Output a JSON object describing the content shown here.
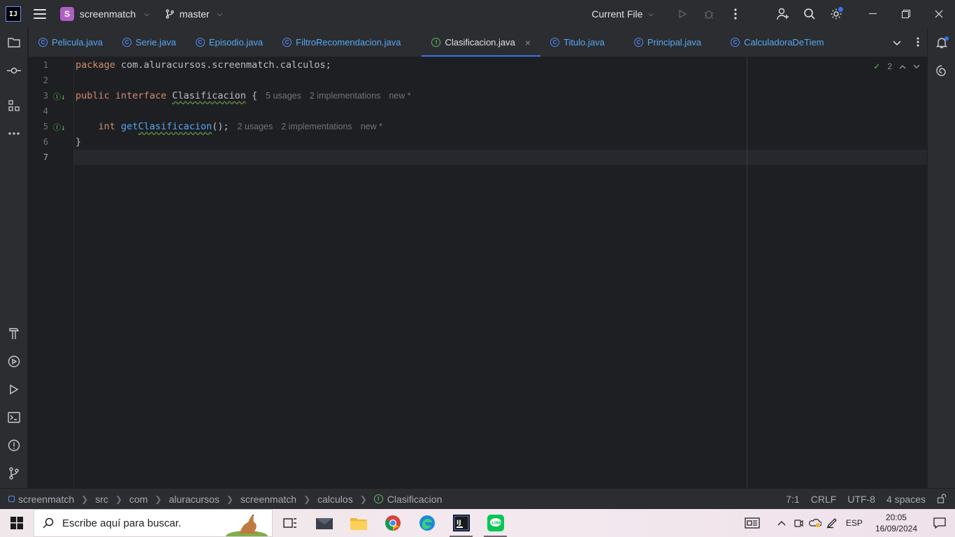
{
  "titlebar": {
    "logo_text": "IJ",
    "project_initial": "S",
    "project_name": "screenmatch",
    "branch": "master",
    "run_config": "Current File"
  },
  "tabs": [
    {
      "label": "Pelicula.java",
      "active": false
    },
    {
      "label": "Serie.java",
      "active": false
    },
    {
      "label": "Episodio.java",
      "active": false
    },
    {
      "label": "FiltroRecomendacion.java",
      "active": false
    },
    {
      "label": "Clasificacion.java",
      "active": true
    },
    {
      "label": "Titulo.java",
      "active": false
    },
    {
      "label": "Principal.java",
      "active": false
    },
    {
      "label": "CalculadoraDeTiem",
      "active": false
    }
  ],
  "editor": {
    "line_numbers": [
      "1",
      "2",
      "3",
      "4",
      "5",
      "6",
      "7"
    ],
    "inspection_count": "2",
    "line1": {
      "kw": "package",
      "rest": " com.aluracursos.screenmatch.calculos;"
    },
    "line3": {
      "kw1": "public",
      "kw2": "interface",
      "type": "Clasificacion",
      "rest": " {",
      "hint_usages": "5 usages",
      "hint_impl": "2 implementations",
      "hint_new": "new *"
    },
    "line5": {
      "kw": "int",
      "fn_prefix": "get",
      "fn_name": "Clasificacion",
      "rest": "();",
      "hint_usages": "2 usages",
      "hint_impl": "2 implementations",
      "hint_new": "new *"
    },
    "line6": "}"
  },
  "statusbar": {
    "breadcrumb": [
      "screenmatch",
      "src",
      "com",
      "aluracursos",
      "screenmatch",
      "calculos",
      "Clasificacion"
    ],
    "position": "7:1",
    "line_separator": "CRLF",
    "encoding": "UTF-8",
    "indent": "4 spaces"
  },
  "taskbar": {
    "search_placeholder": "Escribe aquí para buscar.",
    "language": "ESP",
    "time": "20:05",
    "date": "16/09/2024"
  },
  "colors": {
    "accent": "#3574f0",
    "keyword": "#cf8e6d",
    "function": "#56a8f5",
    "tab_link": "#57a8f5",
    "project_badge": "#b05fc4"
  }
}
